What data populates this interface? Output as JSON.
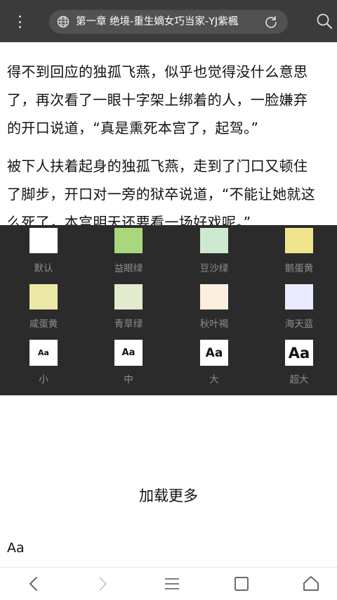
{
  "browser": {
    "url_title": "第一章 绝境-重生嫡女巧当家-YJ紫楓"
  },
  "reader": {
    "paragraphs": [
      {
        "lines": [
          "得不到回应的独孤飞燕，似乎也觉得没什么意思",
          "了，再次看了一眼十字架上绑着的人，一脸嫌弃",
          "的开口说道，“真是熏死本宫了，起驾。”"
        ]
      },
      {
        "lines": [
          "被下人扶着起身的独孤飞燕，走到了门口又顿住",
          "了脚步，开口对一旁的狱卒说道，“不能让她就这",
          "么死了，本宫明天还要看一场好戏呢。”"
        ]
      }
    ]
  },
  "theme_panel": {
    "colors": [
      {
        "label": "默认",
        "color": "#ffffff"
      },
      {
        "label": "益眼绿",
        "color": "#a9d77b"
      },
      {
        "label": "豆沙绿",
        "color": "#cde9d0"
      },
      {
        "label": "鹅蛋黄",
        "color": "#efe48d"
      },
      {
        "label": "咸蛋黄",
        "color": "#ebe7a6"
      },
      {
        "label": "青草绿",
        "color": "#e1ebcd"
      },
      {
        "label": "秋叶褐",
        "color": "#fdefe0"
      },
      {
        "label": "海天蓝",
        "color": "#eaeafe"
      }
    ],
    "font_sizes": [
      {
        "label": "小",
        "sample": "Aa"
      },
      {
        "label": "中",
        "sample": "Aa"
      },
      {
        "label": "大",
        "sample": "Aa"
      },
      {
        "label": "超大",
        "sample": "Aa"
      }
    ]
  },
  "load_more_label": "加载更多",
  "footer_aa": "Aa",
  "icons": {
    "menu": "more-vertical-icon",
    "site": "globe-icon",
    "reload": "reload-icon",
    "search": "search-icon",
    "back": "chevron-left-icon",
    "forward": "chevron-right-icon",
    "menu_bar": "hamburger-icon",
    "tabs": "tabs-square-icon",
    "home": "home-icon"
  }
}
